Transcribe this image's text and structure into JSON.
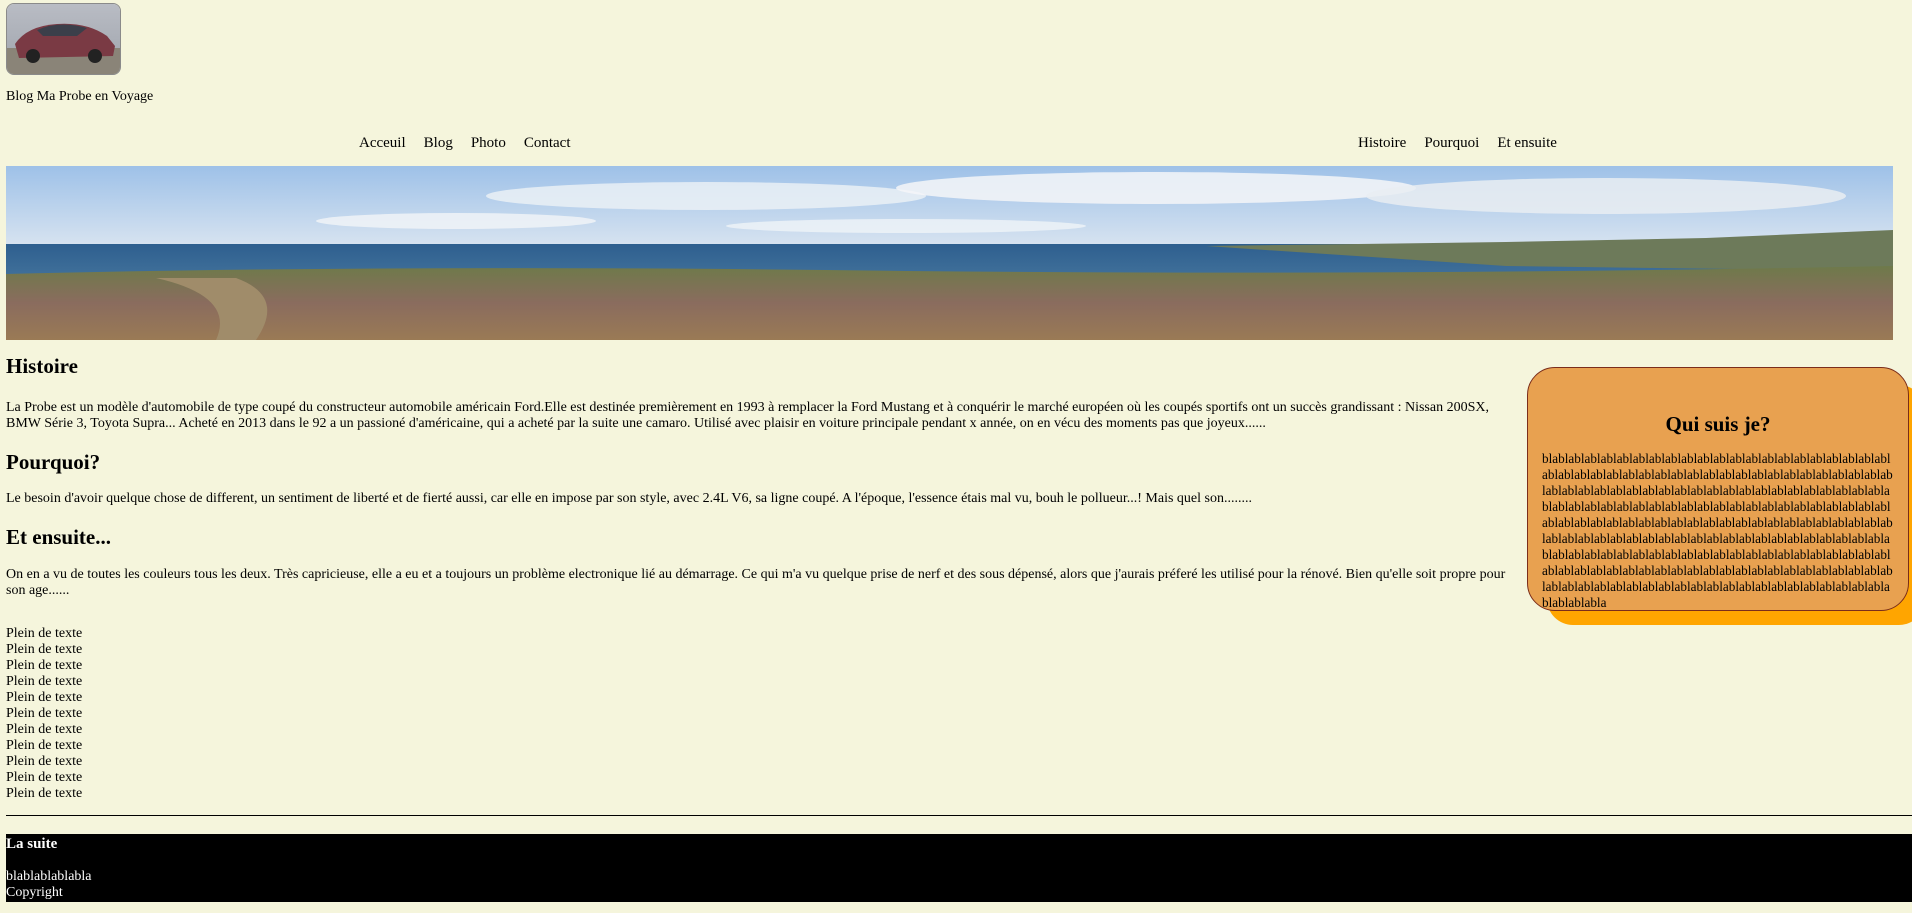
{
  "header": {
    "logo_alt": "car-photo",
    "site_title": "Blog Ma Probe en Voyage"
  },
  "nav_left": [
    "Acceuil",
    "Blog",
    "Photo",
    "Contact"
  ],
  "nav_right": [
    "Histoire",
    "Pourquoi",
    "Et ensuite"
  ],
  "sections": {
    "histoire": {
      "title": "Histoire",
      "text": "La Probe est un modèle d'automobile de type coupé du constructeur automobile américain Ford.Elle est destinée premièrement en 1993 à remplacer la Ford Mustang et à conquérir le marché européen où les coupés sportifs ont un succès grandissant : Nissan 200SX, BMW Série 3, Toyota Supra... Acheté en 2013 dans le 92 a un passioné d'américaine, qui a acheté par la suite une camaro. Utilisé avec plaisir en voiture principale pendant x année, on en vécu des moments pas que joyeux......"
    },
    "pourquoi": {
      "title": "Pourquoi?",
      "text": "Le besoin d'avoir quelque chose de different, un sentiment de liberté et de fierté aussi, car elle en impose par son style, avec 2.4L V6, sa ligne coupé. A l'époque, l'essence étais mal vu, bouh le pollueur...! Mais quel son........"
    },
    "ensuite": {
      "title": "Et ensuite...",
      "text": "On en a vu de toutes les couleurs tous les deux. Très capricieuse, elle a eu et a toujours un problème electronique lié au démarrage. Ce qui m'a vu quelque prise de nerf et des sous dépensé, alors que j'aurais préferé les utilisé pour la rénové. Bien qu'elle soit propre pour son age......"
    }
  },
  "plein": [
    "Plein de texte",
    "Plein de texte",
    "Plein de texte",
    "Plein de texte",
    "Plein de texte",
    "Plein de texte",
    "Plein de texte",
    "Plein de texte",
    "Plein de texte",
    "Plein de texte",
    "Plein de texte"
  ],
  "aside": {
    "title": "Qui suis je?",
    "text": "blablablablablablablablablablablablablablablablablablablablablablablablablablablablablablablablablablablablablablablablablablablablablablablablablablablablablablablablablablablablablablablablablablablablablablablablablablablablablablablablablablablablablablablablablablablablablablablablablablablablablablablablablablablablablablablablablablablablablablablablablablablablablablablablablablablablablablablablablablablablablablablablablablablablablablablablablablablablablablablablablablablablablablablablablablablablablablablablablablablablablablablablablablablablablablablablablablablablablablabla"
  },
  "footer": {
    "title": "La suite",
    "line1": "blablablablabla",
    "line2": "Copyright"
  },
  "colors": {
    "background": "#f5f5dc",
    "aside_bg": "#e8a150",
    "aside_shadow": "#ffa500",
    "footer_bg": "#000000"
  }
}
